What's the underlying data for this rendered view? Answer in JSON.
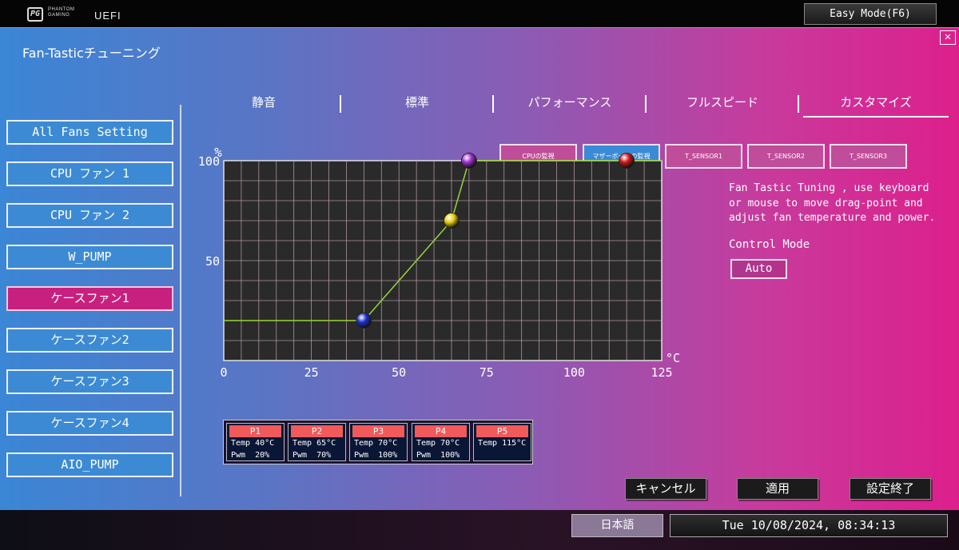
{
  "topbar": {
    "logo_mark": "PG",
    "logo_text": "PHANTOM GAMING",
    "uefi": "UEFI",
    "easy_mode": "Easy Mode(F6)"
  },
  "page": {
    "title": "Fan-Tasticチューニング",
    "close": "✕"
  },
  "sidebar": {
    "items": [
      {
        "label": "All Fans Setting"
      },
      {
        "label": "CPU ファン 1"
      },
      {
        "label": "CPU ファン 2"
      },
      {
        "label": "W_PUMP"
      },
      {
        "label": "ケースファン1",
        "active": true
      },
      {
        "label": "ケースファン2"
      },
      {
        "label": "ケースファン3"
      },
      {
        "label": "ケースファン4"
      },
      {
        "label": "AIO_PUMP"
      }
    ]
  },
  "tabs": [
    "静音",
    "標準",
    "パフォーマンス",
    "フルスピード",
    "カスタマイズ"
  ],
  "active_tab": "カスタマイズ",
  "sensors": [
    "CPUの監視",
    "マザーボードの監視",
    "T_SENSOR1",
    "T_SENSOR2",
    "T_SENSOR3"
  ],
  "active_sensor": "マザーボードの監視",
  "chart_data": {
    "type": "line",
    "xlabel": "°C",
    "ylabel": "%",
    "xlim": [
      0,
      125
    ],
    "ylim": [
      0,
      100
    ],
    "x_ticks": [
      "0",
      "25",
      "50",
      "75",
      "100",
      "125"
    ],
    "y_ticks": [
      "100",
      "50"
    ],
    "grid": true,
    "points": [
      {
        "name": "P1",
        "x": 40,
        "y": 20,
        "color": "#1f2fd0"
      },
      {
        "name": "P2",
        "x": 65,
        "y": 70,
        "color": "#e8d010"
      },
      {
        "name": "P3",
        "x": 70,
        "y": 100,
        "color": "#a030d0"
      },
      {
        "name": "P4",
        "x": 70,
        "y": 100,
        "color": "#a030d0"
      },
      {
        "name": "P5",
        "x": 115,
        "y": 100,
        "color": "#d01818"
      }
    ]
  },
  "points_legend": [
    {
      "name": "P1",
      "temp": "Temp 40°C",
      "pwm": "Pwm  20%"
    },
    {
      "name": "P2",
      "temp": "Temp 65°C",
      "pwm": "Pwm  70%"
    },
    {
      "name": "P3",
      "temp": "Temp 70°C",
      "pwm": "Pwm  100%"
    },
    {
      "name": "P4",
      "temp": "Temp 70°C",
      "pwm": "Pwm  100%"
    },
    {
      "name": "P5",
      "temp": "Temp 115°C",
      "pwm": ""
    }
  ],
  "help": {
    "line1": "Fan Tastic Tuning , use keyboard",
    "line2": "or mouse to move drag-point and",
    "line3": "adjust fan temperature and power."
  },
  "control_mode": {
    "label": "Control Mode",
    "value": "Auto"
  },
  "actions": {
    "cancel": "キャンセル",
    "apply": "適用",
    "finish": "設定終了"
  },
  "status": {
    "language": "日本語",
    "datetime": "Tue 10/08/2024, 08:34:13"
  },
  "colors": {
    "accent_pink": "#c8207e",
    "accent_blue": "#3a8ad8",
    "legend_header": "#f05a5a"
  }
}
